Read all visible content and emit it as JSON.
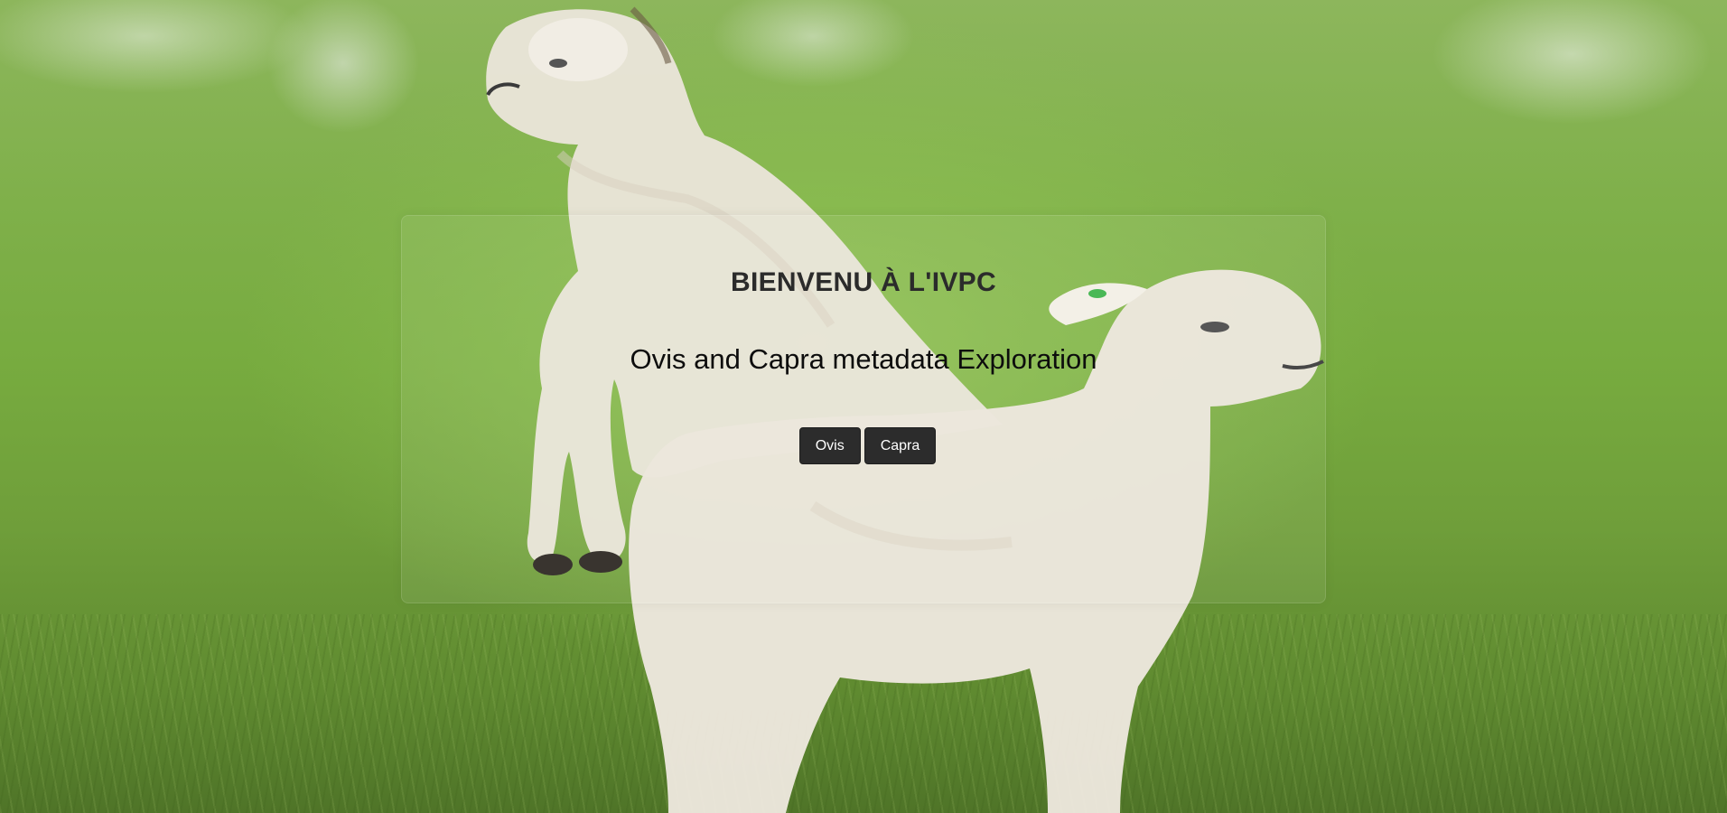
{
  "hero": {
    "background_image": "two-lambs-in-grassy-field",
    "accent_color": "#2c2c2c"
  },
  "welcome": {
    "title": "BIENVENU À L'IVPC",
    "subtitle": "Ovis and Capra metadata Exploration"
  },
  "buttons": [
    {
      "label": "Ovis"
    },
    {
      "label": "Capra"
    }
  ]
}
